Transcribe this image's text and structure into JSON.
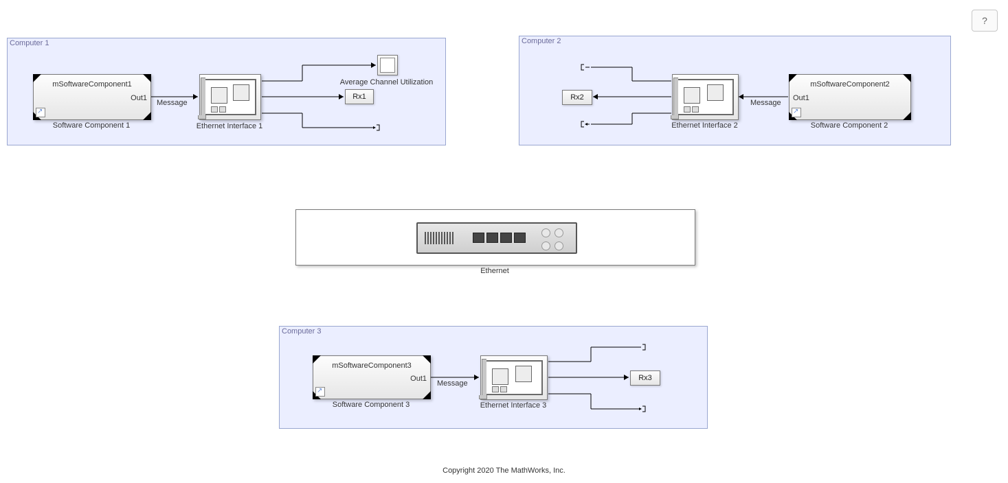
{
  "help_button": "?",
  "copyright": "Copyright 2020 The MathWorks, Inc.",
  "ethernet_label": "Ethernet",
  "computer1": {
    "title": "Computer 1",
    "sw_block_text": "mSoftwareComponent1",
    "sw_port": "Out1",
    "sw_label": "Software Component 1",
    "signal": "Message",
    "eth_label": "Ethernet Interface 1",
    "scope_label": "Average Channel Utilization",
    "rx_label": "Rx1"
  },
  "computer2": {
    "title": "Computer 2",
    "sw_block_text": "mSoftwareComponent2",
    "sw_port": "Out1",
    "sw_label": "Software Component 2",
    "signal": "Message",
    "eth_label": "Ethernet Interface 2",
    "rx_label": "Rx2"
  },
  "computer3": {
    "title": "Computer 3",
    "sw_block_text": "mSoftwareComponent3",
    "sw_port": "Out1",
    "sw_label": "Software Component 3",
    "signal": "Message",
    "eth_label": "Ethernet Interface 3",
    "rx_label": "Rx3"
  }
}
